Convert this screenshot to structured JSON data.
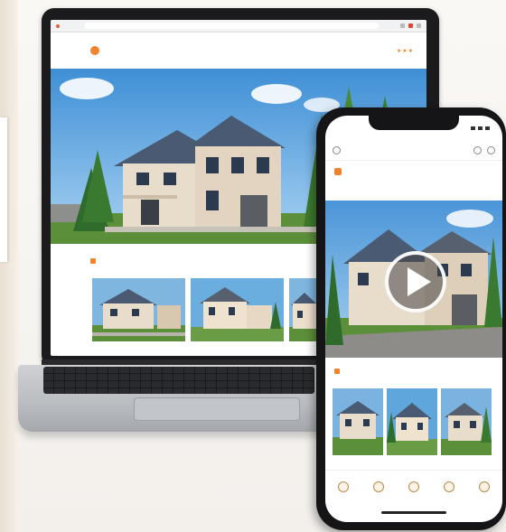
{
  "laptop": {
    "browser": {
      "tab_title": "",
      "url": ""
    },
    "site": {
      "logo_title": "",
      "logo_subtitle": "",
      "nav_items": [
        "",
        "",
        "",
        "",
        "",
        "",
        ""
      ],
      "rating_symbol": "★★★"
    },
    "gallery_section": {
      "title": "",
      "tag": ""
    }
  },
  "phone": {
    "status_time": "",
    "app_bar_label": "",
    "brand_title": "",
    "gallery_section": {
      "title": ""
    },
    "tabbar": [
      "",
      "",
      "",
      "",
      ""
    ]
  },
  "colors": {
    "accent": "#f0842c",
    "sky": "#5ba3dc",
    "lawn": "#5c8f3a",
    "house_wall": "#e8dccb",
    "roof": "#4a5a72"
  },
  "icons": {
    "play": "play-icon",
    "search": "search-icon",
    "menu": "menu-icon"
  }
}
